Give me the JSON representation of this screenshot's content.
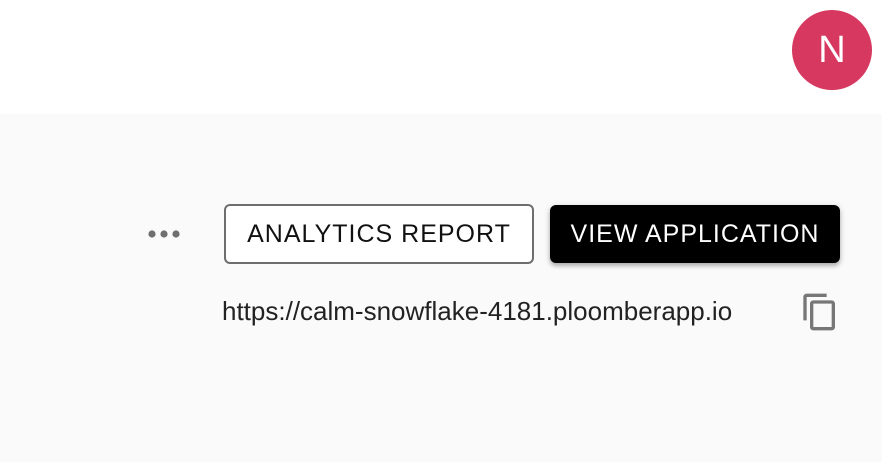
{
  "header": {
    "avatar_initial": "N",
    "avatar_color": "#d6385f"
  },
  "actions": {
    "more_icon": "more-horizontal-icon",
    "analytics_report_label": "ANALYTICS REPORT",
    "view_application_label": "VIEW APPLICATION"
  },
  "app": {
    "url": "https://calm-snowflake-4181.ploomberapp.io",
    "copy_icon": "copy-icon"
  }
}
